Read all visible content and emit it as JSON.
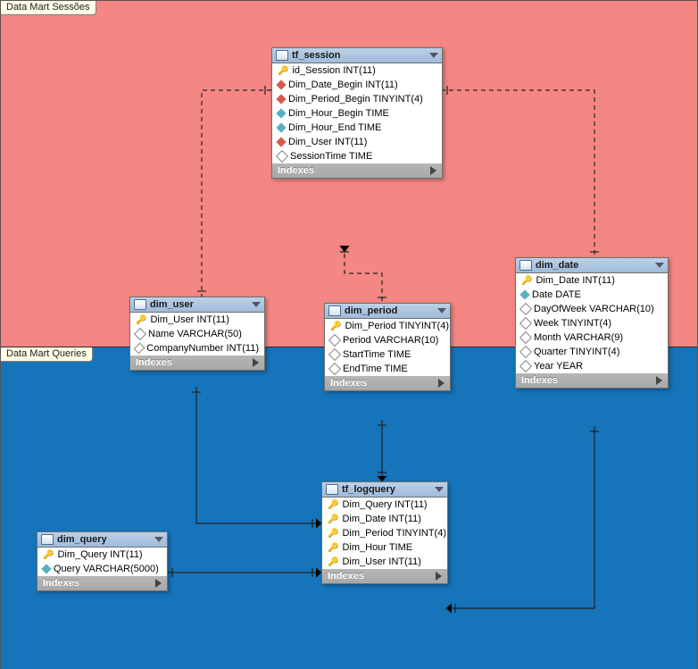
{
  "regions": {
    "sessoes": "Data Mart Sessões",
    "queries": "Data Mart Queries"
  },
  "indexes_label": "Indexes",
  "tables": {
    "tf_session": {
      "title": "tf_session",
      "cols": [
        {
          "icon": "key",
          "text": "id_Session INT(11)"
        },
        {
          "icon": "fk",
          "text": "Dim_Date_Begin INT(11)"
        },
        {
          "icon": "fk",
          "text": "Dim_Period_Begin TINYINT(4)"
        },
        {
          "icon": "fkblue",
          "text": "Dim_Hour_Begin TIME"
        },
        {
          "icon": "fkblue",
          "text": "Dim_Hour_End TIME"
        },
        {
          "icon": "fk",
          "text": "Dim_User INT(11)"
        },
        {
          "icon": "dmd",
          "text": "SessionTime TIME"
        }
      ]
    },
    "dim_user": {
      "title": "dim_user",
      "cols": [
        {
          "icon": "key",
          "text": "Dim_User INT(11)"
        },
        {
          "icon": "dmd",
          "text": "Name VARCHAR(50)"
        },
        {
          "icon": "dmd",
          "text": "CompanyNumber INT(11)"
        }
      ]
    },
    "dim_period": {
      "title": "dim_period",
      "cols": [
        {
          "icon": "key",
          "text": "Dim_Period TINYINT(4)"
        },
        {
          "icon": "dmd",
          "text": "Period VARCHAR(10)"
        },
        {
          "icon": "dmd",
          "text": "StartTime TIME"
        },
        {
          "icon": "dmd",
          "text": "EndTime TIME"
        }
      ]
    },
    "dim_date": {
      "title": "dim_date",
      "cols": [
        {
          "icon": "key",
          "text": "Dim_Date INT(11)"
        },
        {
          "icon": "fkblue",
          "text": "Date DATE"
        },
        {
          "icon": "dmd",
          "text": "DayOfWeek VARCHAR(10)"
        },
        {
          "icon": "dmd",
          "text": "Week TINYINT(4)"
        },
        {
          "icon": "dmd",
          "text": "Month VARCHAR(9)"
        },
        {
          "icon": "dmd",
          "text": "Quarter TINYINT(4)"
        },
        {
          "icon": "dmd",
          "text": "Year YEAR"
        }
      ]
    },
    "dim_query": {
      "title": "dim_query",
      "cols": [
        {
          "icon": "key",
          "text": "Dim_Query INT(11)"
        },
        {
          "icon": "fkblue",
          "text": "Query VARCHAR(5000)"
        }
      ]
    },
    "tf_logquery": {
      "title": "tf_logquery",
      "cols": [
        {
          "icon": "key",
          "text": "Dim_Query INT(11)"
        },
        {
          "icon": "key",
          "text": "Dim_Date INT(11)"
        },
        {
          "icon": "key",
          "text": "Dim_Period TINYINT(4)"
        },
        {
          "icon": "key",
          "text": "Dim_Hour TIME"
        },
        {
          "icon": "key",
          "text": "Dim_User INT(11)"
        }
      ]
    }
  }
}
